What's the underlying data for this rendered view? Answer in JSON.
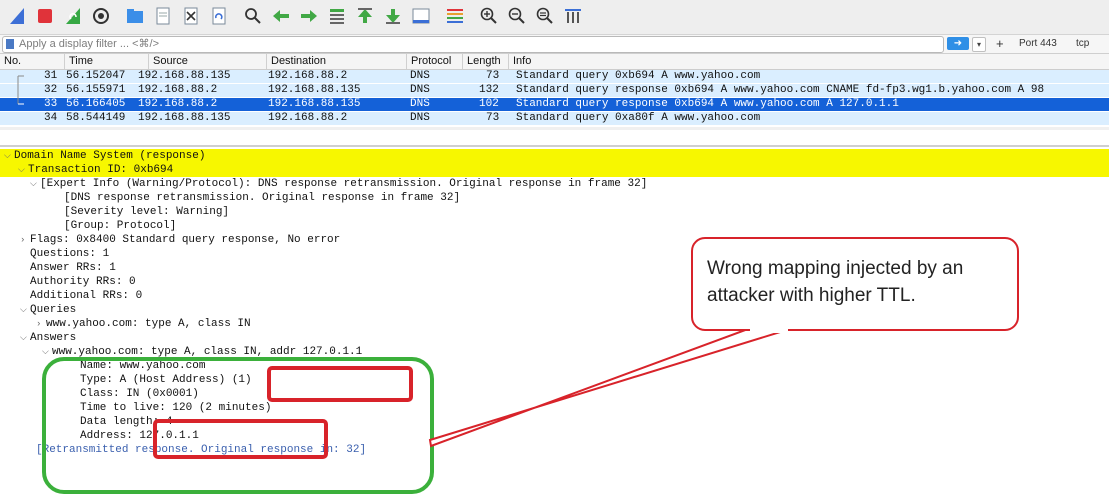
{
  "filter": {
    "placeholder": "Apply a display filter ... <⌘/>",
    "plus": "+",
    "port_button": "Port 443",
    "tcp_button": "tcp"
  },
  "toolbar_icons": [
    "shark-fin-icon",
    "stop-icon",
    "restart-icon",
    "options-icon",
    "open-folder-icon",
    "open-file-icon",
    "close-file-icon",
    "reload-icon",
    "find-icon",
    "go-back-icon",
    "go-forward-icon",
    "go-to-packet-icon",
    "first-packet-icon",
    "last-packet-icon",
    "autoscroll-icon",
    "colorize-icon",
    "zoom-in-icon",
    "zoom-out-icon",
    "normal-size-icon",
    "resize-columns-icon"
  ],
  "columns": {
    "no": "No.",
    "time": "Time",
    "source": "Source",
    "destination": "Destination",
    "protocol": "Protocol",
    "length": "Length",
    "info": "Info"
  },
  "packets": [
    {
      "no": "31",
      "time": "56.152047",
      "source": "192.168.88.135",
      "destination": "192.168.88.2",
      "protocol": "DNS",
      "length": "73",
      "info": "Standard query 0xb694 A www.yahoo.com"
    },
    {
      "no": "32",
      "time": "56.155971",
      "source": "192.168.88.2",
      "destination": "192.168.88.135",
      "protocol": "DNS",
      "length": "132",
      "info": "Standard query response 0xb694 A www.yahoo.com CNAME fd-fp3.wg1.b.yahoo.com A 98"
    },
    {
      "no": "33",
      "time": "56.166405",
      "source": "192.168.88.2",
      "destination": "192.168.88.135",
      "protocol": "DNS",
      "length": "102",
      "info": "Standard query response 0xb694 A www.yahoo.com A 127.0.1.1"
    },
    {
      "no": "34",
      "time": "58.544149",
      "source": "192.168.88.135",
      "destination": "192.168.88.2",
      "protocol": "DNS",
      "length": "73",
      "info": "Standard query 0xa80f A www.yahoo.com"
    }
  ],
  "details": {
    "l0": "Domain Name System (response)",
    "l1": "Transaction ID: 0xb694",
    "l2": "[Expert Info (Warning/Protocol): DNS response retransmission. Original response in frame 32]",
    "l3": "[DNS response retransmission. Original response in frame 32]",
    "l4": "[Severity level: Warning]",
    "l5": "[Group: Protocol]",
    "l6": "Flags: 0x8400 Standard query response, No error",
    "l7": "Questions: 1",
    "l8": "Answer RRs: 1",
    "l9": "Authority RRs: 0",
    "l10": "Additional RRs: 0",
    "l11": "Queries",
    "l12": "www.yahoo.com: type A, class IN",
    "l13": "Answers",
    "l14": "www.yahoo.com: type A, class IN, addr 127.0.1.1",
    "l15": "Name: www.yahoo.com",
    "l16": "Type: A (Host Address) (1)",
    "l17": "Class: IN (0x0001)",
    "l18": "Time to live: 120 (2 minutes)",
    "l19": "Data length: 4",
    "l20": "Address: 127.0.1.1",
    "l21": "[Retransmitted response. Original response in: 32]"
  },
  "annotation": {
    "text": "Wrong mapping injected by an attacker with higher TTL."
  },
  "colors": {
    "selected_row": "#1461d8",
    "dns_row": "#daeeff",
    "highlight": "#f7f700",
    "annotation_red": "#d8232a",
    "annotation_green": "#3bb03b"
  }
}
